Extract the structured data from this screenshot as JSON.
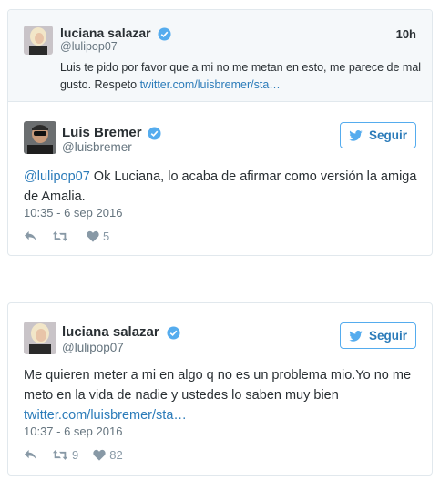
{
  "card1": {
    "quoted": {
      "name": "luciana salazar",
      "handle": "@lulipop07",
      "time": "10h",
      "text_prefix": "Luis te pido por favor que a mi no me metan en esto, me parece de mal gusto. Respeto ",
      "link": "twitter.com/luisbremer/sta…"
    },
    "author": {
      "name": "Luis Bremer",
      "handle": "@luisbremer"
    },
    "follow_label": "Seguir",
    "mention": "@lulipop07",
    "text_rest": " Ok Luciana, lo acaba de afirmar como versión la amiga de Amalia.",
    "date": "10:35 - 6 sep 2016",
    "retweets": "",
    "likes": "5"
  },
  "card2": {
    "author": {
      "name": "luciana salazar",
      "handle": "@lulipop07"
    },
    "follow_label": "Seguir",
    "text": "Me quieren meter a mi en algo q no es un problema mio.Yo no me meto en la vida de nadie y ustedes lo saben muy bien",
    "link": "twitter.com/luisbremer/sta…",
    "date": "10:37 - 6 sep 2016",
    "retweets": "9",
    "likes": "82"
  },
  "colors": {
    "link": "#2b7bb9",
    "verified": "#55acee",
    "muted": "#8899a6"
  },
  "icons": [
    "verified-badge-icon",
    "twitter-bird-icon",
    "reply-icon",
    "retweet-icon",
    "heart-icon"
  ]
}
